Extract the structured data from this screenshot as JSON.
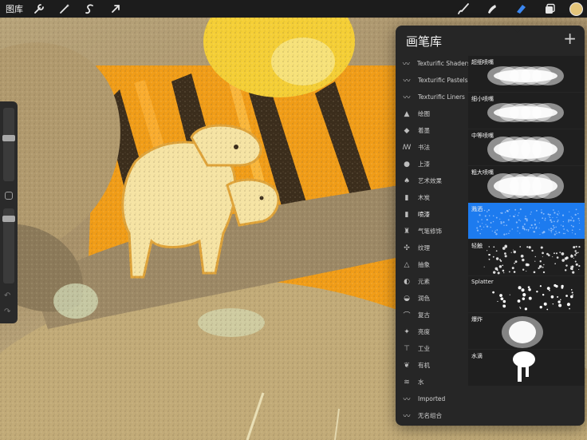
{
  "toolbar": {
    "gallery_label": "图库",
    "left_icons": [
      "wrench-icon",
      "magic-wand-icon",
      "selection-icon",
      "transform-arrow-icon"
    ],
    "right_icons": [
      "paintbrush-icon",
      "smudge-icon",
      "eraser-icon",
      "layers-icon"
    ],
    "current_color": "#e4c57a"
  },
  "sidebar": {
    "brush_size": 0.6,
    "opacity": 0.25
  },
  "brush_library": {
    "title": "画笔库",
    "add_symbol": "+",
    "sets": [
      {
        "label": "Texturific Shaders",
        "icon": "brush-stroke-icon"
      },
      {
        "label": "Texturific Pastels",
        "icon": "brush-stroke-icon"
      },
      {
        "label": "Texturific Liners",
        "icon": "brush-stroke-icon"
      },
      {
        "label": "绘图",
        "icon": "pencil-tip-icon"
      },
      {
        "label": "着墨",
        "icon": "ink-drop-icon"
      },
      {
        "label": "书法",
        "icon": "calligraphy-icon"
      },
      {
        "label": "上漆",
        "icon": "paint-drop-icon"
      },
      {
        "label": "艺术效果",
        "icon": "artistic-brush-icon"
      },
      {
        "label": "木炭",
        "icon": "charcoal-icon"
      },
      {
        "label": "喷漆",
        "icon": "spray-can-icon"
      },
      {
        "label": "气笔修饰",
        "icon": "airbrush-icon"
      },
      {
        "label": "纹理",
        "icon": "texture-icon"
      },
      {
        "label": "抽象",
        "icon": "triangle-icon"
      },
      {
        "label": "元素",
        "icon": "yin-yang-icon"
      },
      {
        "label": "润色",
        "icon": "touchup-icon"
      },
      {
        "label": "复古",
        "icon": "retro-icon"
      },
      {
        "label": "亮度",
        "icon": "sparkle-icon"
      },
      {
        "label": "工业",
        "icon": "anvil-icon"
      },
      {
        "label": "有机",
        "icon": "leaf-icon"
      },
      {
        "label": "水",
        "icon": "waves-icon"
      },
      {
        "label": "Imported",
        "icon": "brush-stroke-icon"
      },
      {
        "label": "无名组合",
        "icon": "brush-stroke-icon"
      }
    ],
    "active_set": "喷漆",
    "brushes": [
      {
        "label": "超细喷嘴",
        "style": "cloud"
      },
      {
        "label": "细小喷嘴",
        "style": "cloud"
      },
      {
        "label": "中等喷嘴",
        "style": "cloud-wide"
      },
      {
        "label": "粗大喷嘴",
        "style": "cloud-wide"
      },
      {
        "label": "溅洒",
        "style": "speckle",
        "selected": true
      },
      {
        "label": "轻触",
        "style": "dots"
      },
      {
        "label": "Splatter",
        "style": "splatter"
      },
      {
        "label": "爆炸",
        "style": "burst"
      },
      {
        "label": "水滴",
        "style": "drip"
      }
    ],
    "selected_brush": "溅洒"
  },
  "colors": {
    "panel_bg": "#262626",
    "selected_brush_bg": "#1d7bef",
    "active_accent": "#3b87f0"
  }
}
